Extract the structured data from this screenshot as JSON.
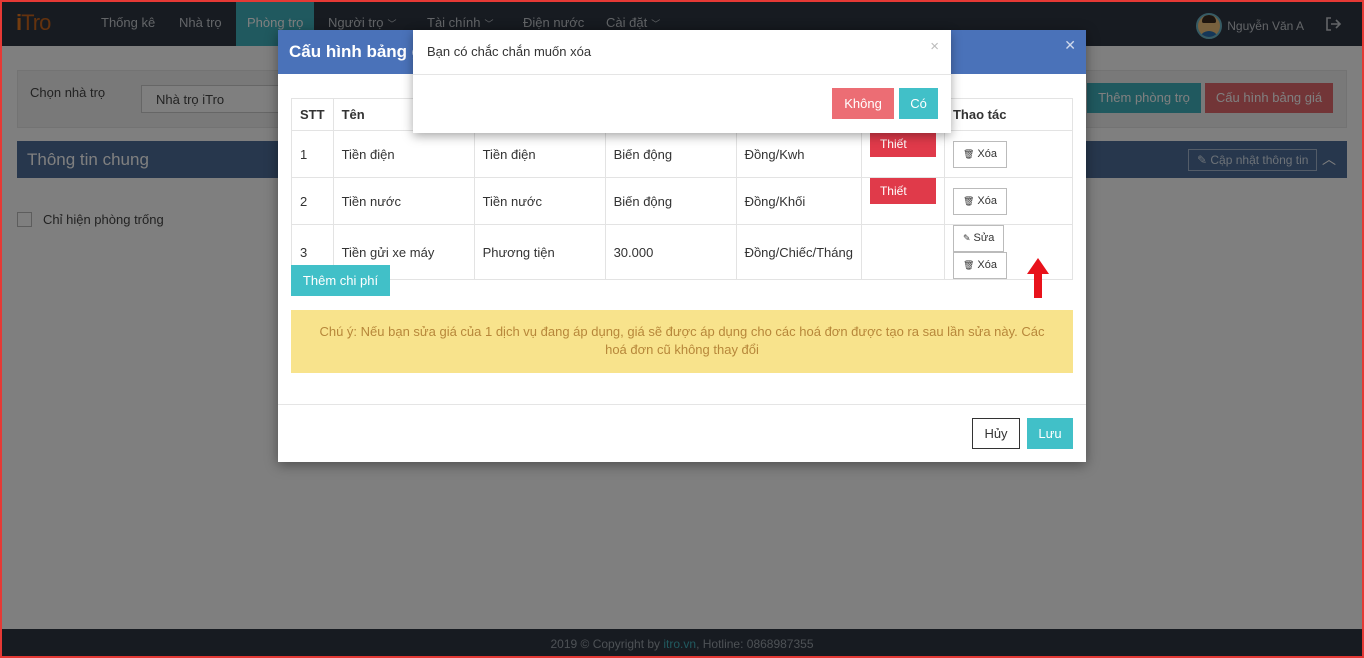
{
  "navbar": {
    "logo_i": "i",
    "logo_tro": "Tro",
    "items": [
      {
        "label": "Thống kê",
        "caret": ""
      },
      {
        "label": "Nhà trọ",
        "caret": ""
      },
      {
        "label": "Phòng trọ",
        "caret": ""
      },
      {
        "label": "Người trọ",
        "caret": "﹀"
      },
      {
        "label": "Tài chính",
        "caret": "﹀"
      },
      {
        "label": "Điện nước",
        "caret": ""
      },
      {
        "label": "Cài đặt",
        "caret": "﹀"
      }
    ],
    "active_index": 2,
    "user_name": "Nguyễn Văn A"
  },
  "page": {
    "choose_label": "Chọn nhà trọ",
    "choose_value": "Nhà trọ iTro",
    "add_room_button": "Thêm phòng trọ",
    "price_config_button": "Cấu hình bảng giá",
    "info_title": "Thông tin chung",
    "update_info_button": "✎ Cập nhật thông tin",
    "only_empty_rooms": "Chỉ hiện phòng trống",
    "footer_prefix": "2019 © Copyright by ",
    "footer_link": "itro.vn",
    "footer_suffix": ", Hotline: 0868987355"
  },
  "modal": {
    "title": "Cấu hình bảng giá",
    "headers": {
      "stt": "STT",
      "name": "Tên",
      "actions": "Thao tác"
    },
    "rows": [
      {
        "stt": "1",
        "name": "Tiền điện",
        "type": "Tiền điện",
        "price": "Biến động",
        "unit": "Đồng/Kwh",
        "setup": "Thiết lập",
        "edit": "",
        "delete": "Xóa"
      },
      {
        "stt": "2",
        "name": "Tiền nước",
        "type": "Tiền nước",
        "price": "Biến động",
        "unit": "Đồng/Khối",
        "setup": "Thiết lập",
        "edit": "",
        "delete": "Xóa"
      },
      {
        "stt": "3",
        "name": "Tiền gửi xe máy",
        "type": "Phương tiện",
        "price": "30.000",
        "unit": "Đồng/Chiếc/Tháng",
        "setup": "",
        "edit": "Sửa",
        "delete": "Xóa"
      }
    ],
    "add_fee_button": "Thêm chi phí",
    "note": "Chú ý: Nếu bạn sửa giá của 1 dịch vụ đang áp dụng, giá sẽ được áp dụng cho các hoá đơn được tạo ra sau lần sửa này. Các hoá đơn cũ không thay đổi",
    "cancel_button": "Hủy",
    "save_button": "Lưu"
  },
  "confirm": {
    "message": "Bạn có chắc chắn muốn xóa",
    "no_button": "Không",
    "yes_button": "Có"
  },
  "colors": {
    "navbar": "#2f3742",
    "accent_teal": "#41c0c8",
    "danger_red": "#e03a4a",
    "modal_header": "#4a72b9",
    "note_bg": "#f8e38c",
    "annotation_arrow": "#e8121b",
    "frame_border": "#e53935"
  }
}
